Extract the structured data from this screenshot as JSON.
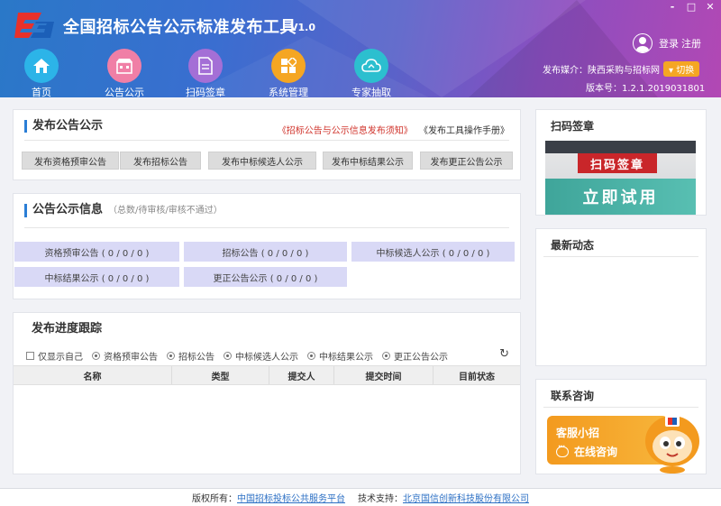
{
  "window": {
    "minimize": "-",
    "maximize": "□",
    "close": "✕"
  },
  "header": {
    "title": "全国招标公告公示标准发布工具",
    "version_badge": "V1.0",
    "login": "登录",
    "register": "注册",
    "publisher_label": "发布媒介：陕西采购与招标网",
    "switch_label": "▾ 切换",
    "version_line": "版本号：1.2.1.2019031801"
  },
  "nav": [
    {
      "label": "首页",
      "icon": "home-icon",
      "color": "#2cb4e8"
    },
    {
      "label": "公告公示",
      "icon": "shop-icon",
      "color": "#f07fa6"
    },
    {
      "label": "扫码签章",
      "icon": "document-icon",
      "color": "#a46fd6"
    },
    {
      "label": "系统管理",
      "icon": "grid-icon",
      "color": "#f5a623"
    },
    {
      "label": "专家抽取",
      "icon": "cloud-icon",
      "color": "#2cbfcf"
    }
  ],
  "publish": {
    "title": "发布公告公示",
    "link_notice": "《招标公告与公示信息发布须知》",
    "link_manual": "《发布工具操作手册》",
    "buttons": [
      "发布资格预审公告",
      "发布招标公告",
      "发布中标候选人公示",
      "发布中标结果公示",
      "发布更正公告公示"
    ]
  },
  "info": {
    "title": "公告公示信息",
    "subtitle": "（总数/待审核/审核不通过）",
    "stats": [
      "资格预审公告 ( 0 / 0 / 0 )",
      "招标公告 ( 0 / 0 / 0 )",
      "中标候选人公示 ( 0 / 0 / 0 )",
      "中标结果公示 ( 0 / 0 / 0 )",
      "更正公告公示 ( 0 / 0 / 0 )"
    ]
  },
  "progress": {
    "title": "发布进度跟踪",
    "only_mine": "仅显示自己",
    "filters": [
      "资格预审公告",
      "招标公告",
      "中标候选人公示",
      "中标结果公示",
      "更正公告公示"
    ],
    "refresh_icon": "↻",
    "columns": [
      "名称",
      "类型",
      "提交人",
      "提交时间",
      "目前状态"
    ]
  },
  "scan": {
    "title": "扫码签章",
    "banner_tag": "扫码签章",
    "banner_cta": "立即试用"
  },
  "news": {
    "title": "最新动态"
  },
  "contact": {
    "title": "联系咨询",
    "service_name": "客服小招",
    "online": "在线咨询"
  },
  "footer": {
    "copyright_label": "版权所有：",
    "copyright_link": "中国招标投标公共服务平台",
    "support_label": "技术支持：",
    "support_link": "北京国信创新科技股份有限公司"
  }
}
